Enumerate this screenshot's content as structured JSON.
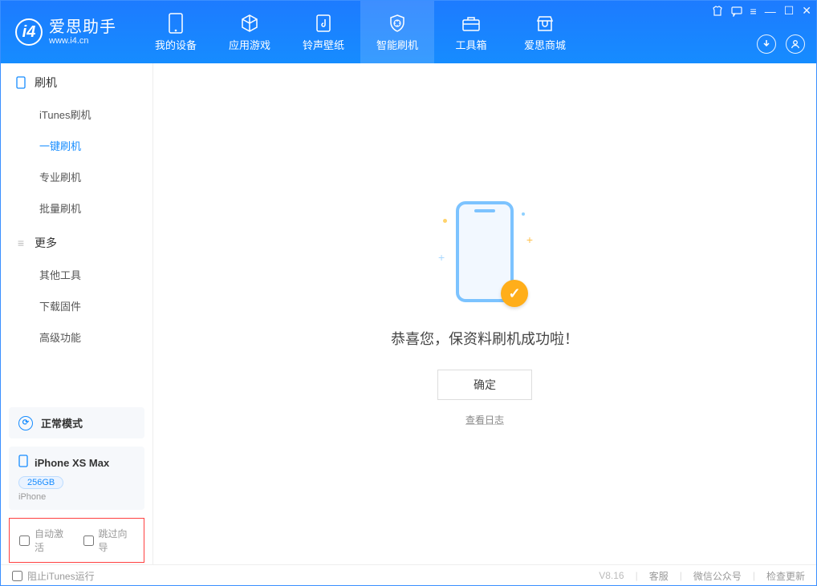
{
  "header": {
    "logo_cn": "爱思助手",
    "logo_url": "www.i4.cn",
    "nav": [
      {
        "label": "我的设备",
        "icon": "device-icon"
      },
      {
        "label": "应用游戏",
        "icon": "cube-icon"
      },
      {
        "label": "铃声壁纸",
        "icon": "music-icon"
      },
      {
        "label": "智能刷机",
        "icon": "shield-icon"
      },
      {
        "label": "工具箱",
        "icon": "toolbox-icon"
      },
      {
        "label": "爱思商城",
        "icon": "shop-icon"
      }
    ],
    "active_nav_index": 3
  },
  "sidebar": {
    "sections": [
      {
        "title": "刷机",
        "icon": "phone-outline-icon",
        "items": [
          {
            "label": "iTunes刷机"
          },
          {
            "label": "一键刷机",
            "active": true
          },
          {
            "label": "专业刷机"
          },
          {
            "label": "批量刷机"
          }
        ]
      },
      {
        "title": "更多",
        "icon": "menu-icon",
        "items": [
          {
            "label": "其他工具"
          },
          {
            "label": "下载固件"
          },
          {
            "label": "高级功能"
          }
        ]
      }
    ],
    "mode_label": "正常模式",
    "device": {
      "name": "iPhone XS Max",
      "capacity": "256GB",
      "type": "iPhone"
    },
    "checkboxes": {
      "auto_activate": "自动激活",
      "skip_setup": "跳过向导"
    }
  },
  "main": {
    "success_text": "恭喜您，保资料刷机成功啦！",
    "ok_label": "确定",
    "view_log": "查看日志"
  },
  "footer": {
    "block_itunes": "阻止iTunes运行",
    "version": "V8.16",
    "links": [
      "客服",
      "微信公众号",
      "检查更新"
    ]
  }
}
